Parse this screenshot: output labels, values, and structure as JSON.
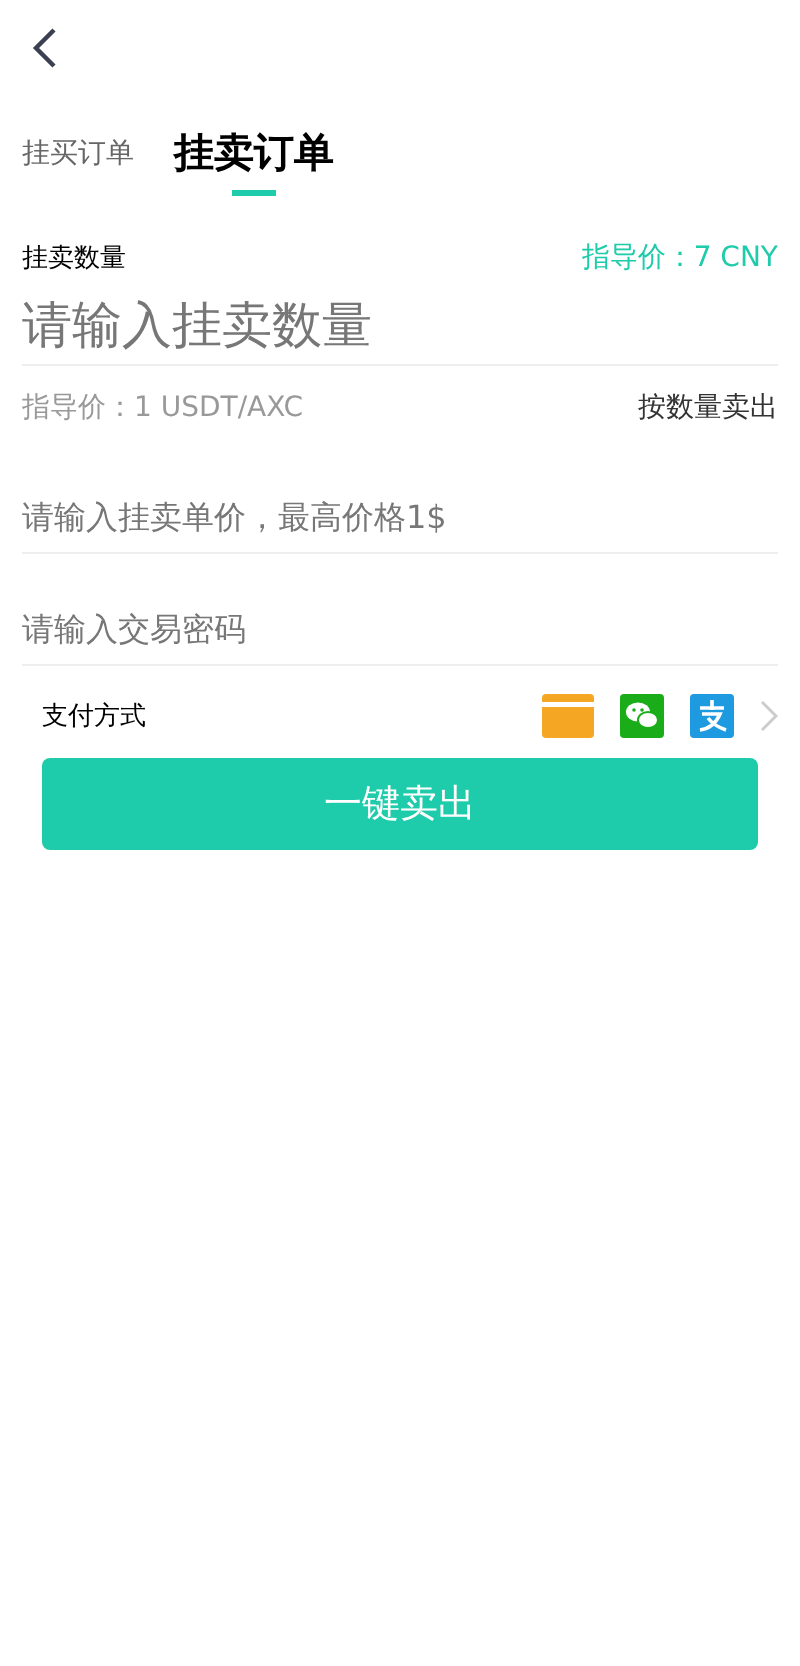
{
  "tabs": [
    {
      "label": "挂买订单",
      "selected": false
    },
    {
      "label": "挂卖订单",
      "selected": true
    }
  ],
  "quantity": {
    "label": "挂卖数量",
    "guide": "指导价：7 CNY",
    "placeholder": "请输入挂卖数量"
  },
  "rate": {
    "text": "指导价：1 USDT/AXC",
    "link": "按数量卖出"
  },
  "price_field": {
    "placeholder": "请输入挂卖单价，最高价格1$"
  },
  "password_field": {
    "placeholder": "请输入交易密码"
  },
  "payment": {
    "label": "支付方式",
    "methods": [
      {
        "kind": "card"
      },
      {
        "kind": "wechat"
      },
      {
        "kind": "alipay"
      }
    ]
  },
  "submit": "一键卖出"
}
